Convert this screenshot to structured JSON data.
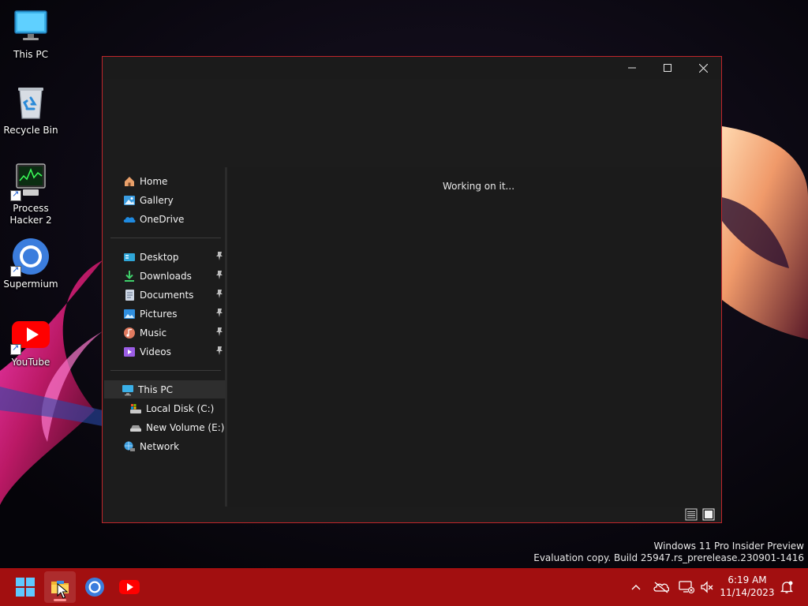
{
  "desktop": {
    "icons": [
      {
        "label": "This PC",
        "icon": "monitor-icon"
      },
      {
        "label": "Recycle Bin",
        "icon": "recycle-bin-icon"
      },
      {
        "label": "Process\nHacker 2",
        "line1": "Process",
        "line2": "Hacker 2",
        "icon": "process-hacker-icon"
      },
      {
        "label": "Supermium",
        "icon": "supermium-icon"
      },
      {
        "label": "YouTube",
        "icon": "youtube-icon"
      }
    ]
  },
  "explorer": {
    "caption_buttons": {
      "minimize": "minimize",
      "maximize": "maximize",
      "close": "close"
    },
    "nav": {
      "quick": [
        {
          "label": "Home",
          "icon": "home-icon"
        },
        {
          "label": "Gallery",
          "icon": "gallery-icon"
        },
        {
          "label": "OneDrive",
          "icon": "onedrive-icon"
        }
      ],
      "pinned": [
        {
          "label": "Desktop",
          "icon": "desktop-folder-icon"
        },
        {
          "label": "Downloads",
          "icon": "downloads-icon"
        },
        {
          "label": "Documents",
          "icon": "documents-icon"
        },
        {
          "label": "Pictures",
          "icon": "pictures-icon"
        },
        {
          "label": "Music",
          "icon": "music-icon"
        },
        {
          "label": "Videos",
          "icon": "videos-icon"
        }
      ],
      "this_pc": {
        "label": "This PC",
        "icon": "monitor-icon"
      },
      "drives": [
        {
          "label": "Local Disk (C:)",
          "icon": "local-disk-icon"
        },
        {
          "label": "New Volume (E:)",
          "icon": "drive-icon"
        }
      ],
      "network": {
        "label": "Network",
        "icon": "network-icon"
      }
    },
    "content": {
      "status": "Working on it..."
    }
  },
  "watermark": {
    "line1": "Windows 11 Pro Insider Preview",
    "line2": "Evaluation copy. Build 25947.rs_prerelease.230901-1416"
  },
  "taskbar": {
    "apps": [
      "start-icon",
      "file-explorer-icon",
      "supermium-icon",
      "youtube-icon"
    ],
    "tray": [
      "chevron-up-icon",
      "onedrive-offline-icon",
      "network-disconnected-icon",
      "volume-muted-icon",
      "notifications-icon"
    ],
    "time": "6:19 AM",
    "date": "11/14/2023"
  },
  "colors": {
    "accent": "#c0262b",
    "taskbar": "#a20f10",
    "window_bg": "#1b1b1b"
  }
}
